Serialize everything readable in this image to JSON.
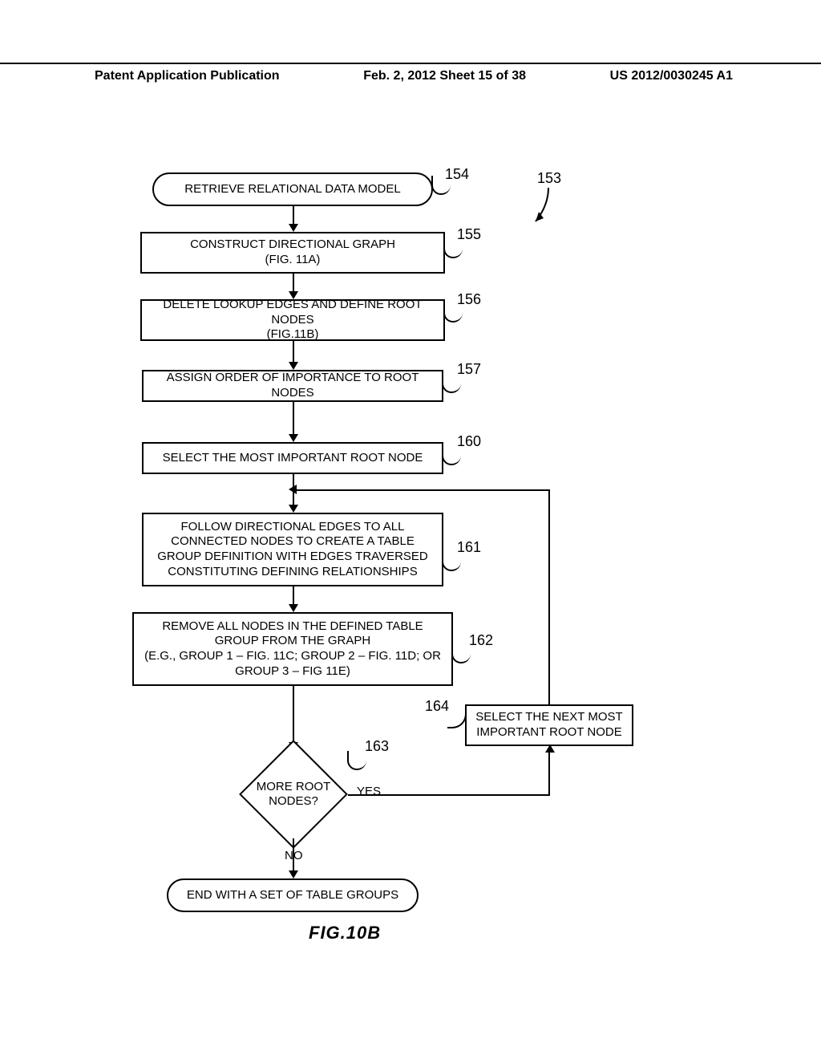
{
  "header": {
    "left": "Patent Application Publication",
    "mid": "Feb. 2, 2012  Sheet 15 of 38",
    "right": "US 2012/0030245 A1"
  },
  "refs": {
    "r153": "153",
    "r154": "154",
    "r155": "155",
    "r156": "156",
    "r157": "157",
    "r160": "160",
    "r161": "161",
    "r162": "162",
    "r163": "163",
    "r164": "164"
  },
  "steps": {
    "start": "RETRIEVE RELATIONAL DATA MODEL",
    "s155": "CONSTRUCT DIRECTIONAL GRAPH\n(FIG. 11A)",
    "s156": "DELETE LOOKUP EDGES AND DEFINE ROOT NODES\n(FIG.11B)",
    "s157": "ASSIGN ORDER OF IMPORTANCE TO ROOT NODES",
    "s160": "SELECT THE MOST IMPORTANT ROOT NODE",
    "s161": "FOLLOW DIRECTIONAL EDGES TO ALL CONNECTED NODES TO CREATE A TABLE GROUP DEFINITION WITH EDGES TRAVERSED CONSTITUTING DEFINING RELATIONSHIPS",
    "s162": "REMOVE ALL NODES IN THE DEFINED TABLE GROUP FROM THE GRAPH\n(E.G., GROUP 1 – FIG. 11C; GROUP 2 – FIG. 11D; OR GROUP 3 – FIG 11E)",
    "s164": "SELECT THE NEXT MOST IMPORTANT ROOT NODE",
    "end": "END WITH A SET OF TABLE GROUPS"
  },
  "decision": {
    "text": "MORE ROOT NODES?",
    "yes": "YES",
    "no": "NO"
  },
  "figure": "FIG.10B",
  "chart_data": {
    "type": "flowchart",
    "nodes": [
      {
        "id": "154",
        "kind": "terminator",
        "text": "RETRIEVE RELATIONAL DATA MODEL"
      },
      {
        "id": "155",
        "kind": "process",
        "text": "CONSTRUCT DIRECTIONAL GRAPH (FIG. 11A)"
      },
      {
        "id": "156",
        "kind": "process",
        "text": "DELETE LOOKUP EDGES AND DEFINE ROOT NODES (FIG.11B)"
      },
      {
        "id": "157",
        "kind": "process",
        "text": "ASSIGN ORDER OF IMPORTANCE TO ROOT NODES"
      },
      {
        "id": "160",
        "kind": "process",
        "text": "SELECT THE MOST IMPORTANT ROOT NODE"
      },
      {
        "id": "161",
        "kind": "process",
        "text": "FOLLOW DIRECTIONAL EDGES TO ALL CONNECTED NODES TO CREATE A TABLE GROUP DEFINITION WITH EDGES TRAVERSED CONSTITUTING DEFINING RELATIONSHIPS"
      },
      {
        "id": "162",
        "kind": "process",
        "text": "REMOVE ALL NODES IN THE DEFINED TABLE GROUP FROM THE GRAPH (E.G., GROUP 1 – FIG. 11C; GROUP 2 – FIG. 11D; OR GROUP 3 – FIG 11E)"
      },
      {
        "id": "163",
        "kind": "decision",
        "text": "MORE ROOT NODES?"
      },
      {
        "id": "164",
        "kind": "process",
        "text": "SELECT THE NEXT MOST IMPORTANT ROOT NODE"
      },
      {
        "id": "end",
        "kind": "terminator",
        "text": "END WITH A SET OF TABLE GROUPS"
      }
    ],
    "edges": [
      {
        "from": "154",
        "to": "155"
      },
      {
        "from": "155",
        "to": "156"
      },
      {
        "from": "156",
        "to": "157"
      },
      {
        "from": "157",
        "to": "160"
      },
      {
        "from": "160",
        "to": "161"
      },
      {
        "from": "161",
        "to": "162"
      },
      {
        "from": "162",
        "to": "163"
      },
      {
        "from": "163",
        "to": "164",
        "label": "YES"
      },
      {
        "from": "163",
        "to": "end",
        "label": "NO"
      },
      {
        "from": "164",
        "to": "161",
        "kind": "loop"
      }
    ],
    "figure_label": "FIG.10B",
    "overall_ref": "153"
  }
}
